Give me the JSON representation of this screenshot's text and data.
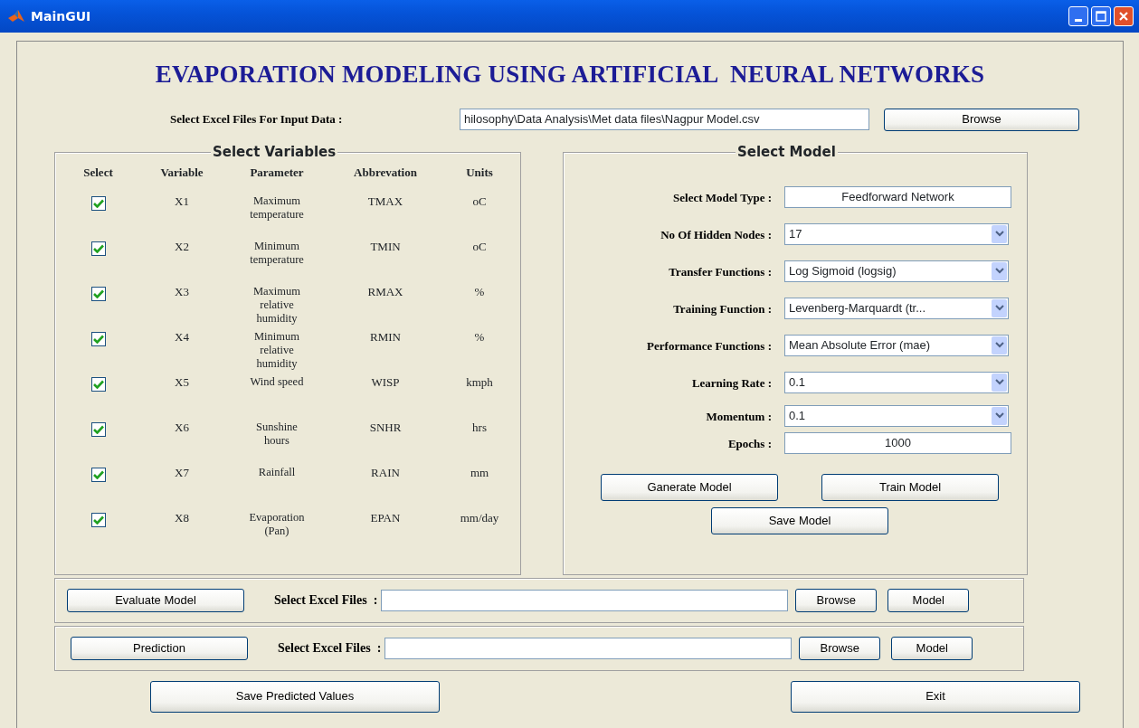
{
  "window": {
    "title": "MainGUI"
  },
  "heading": "EVAPORATION MODELING USING ARTIFICIAL  NEURAL NETWORKS",
  "input_file": {
    "label": "Select Excel Files For Input Data :",
    "value": "hilosophy\\Data Analysis\\Met data files\\Nagpur Model.csv",
    "button": "Browse"
  },
  "variables": {
    "title": "Select Variables",
    "columns": [
      "Select",
      "Variable",
      "Parameter",
      "Abbrevation",
      "Units"
    ],
    "rows": [
      {
        "checked": true,
        "variable": "X1",
        "parameter": "Maximum temperature",
        "abbreviation": "TMAX",
        "units": "oC"
      },
      {
        "checked": true,
        "variable": "X2",
        "parameter": "Minimum temperature",
        "abbreviation": "TMIN",
        "units": "oC"
      },
      {
        "checked": true,
        "variable": "X3",
        "parameter": "Maximum relative humidity",
        "abbreviation": "RMAX",
        "units": "%"
      },
      {
        "checked": true,
        "variable": "X4",
        "parameter": "Minimum relative humidity",
        "abbreviation": "RMIN",
        "units": "%"
      },
      {
        "checked": true,
        "variable": "X5",
        "parameter": "Wind speed",
        "abbreviation": "WISP",
        "units": "kmph"
      },
      {
        "checked": true,
        "variable": "X6",
        "parameter": "Sunshine hours",
        "abbreviation": "SNHR",
        "units": "hrs"
      },
      {
        "checked": true,
        "variable": "X7",
        "parameter": "Rainfall",
        "abbreviation": "RAIN",
        "units": "mm"
      },
      {
        "checked": true,
        "variable": "X8",
        "parameter": "Evaporation (Pan)",
        "abbreviation": "EPAN",
        "units": "mm/day"
      }
    ]
  },
  "model": {
    "title": "Select Model",
    "fields": [
      {
        "kind": "text",
        "label": "Select Model Type :",
        "value": "Feedforward Network"
      },
      {
        "kind": "dropdown",
        "label": "No Of Hidden Nodes :",
        "value": "17"
      },
      {
        "kind": "dropdown",
        "label": "Transfer Functions :",
        "value": "Log Sigmoid (logsig)"
      },
      {
        "kind": "dropdown",
        "label": "Training Function :",
        "value": "Levenberg-Marquardt (tr..."
      },
      {
        "kind": "dropdown",
        "label": "Performance Functions :",
        "value": "Mean Absolute Error (mae)"
      },
      {
        "kind": "dropdown",
        "label": "Learning Rate :",
        "value": "0.1"
      },
      {
        "kind": "dropdown",
        "label": "Momentum :",
        "value": "0.1"
      },
      {
        "kind": "text",
        "label": "Epochs :",
        "value": "1000"
      }
    ],
    "buttons": [
      "Ganerate Model",
      "Train Model",
      "Save Model"
    ]
  },
  "actions": [
    {
      "button": "Evaluate Model",
      "label": "Select Excel Files  :",
      "browse": "Browse",
      "model": "Model"
    },
    {
      "button": "Prediction",
      "label": "Select Excel Files  :",
      "browse": "Browse",
      "model": "Model"
    }
  ],
  "footer_buttons": [
    "Save Predicted Values",
    "Exit"
  ]
}
